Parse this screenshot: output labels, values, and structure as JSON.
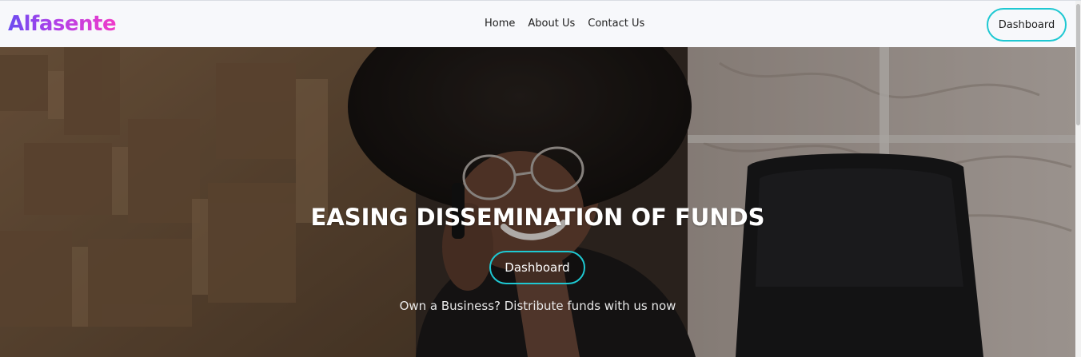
{
  "brand": {
    "name": "Alfasente"
  },
  "nav": {
    "links": [
      "Home",
      "About Us",
      "Contact Us"
    ],
    "dashboard_label": "Dashboard"
  },
  "hero": {
    "title": "EASING DISSEMINATION OF FUNDS",
    "button_label": "Dashboard",
    "subtitle": "Own a Business? Distribute funds with us now"
  },
  "colors": {
    "accent": "#1ec8d2",
    "logo_gradient_start": "#6b4cf0",
    "logo_gradient_end": "#f03cc8",
    "hero_text": "#ffffff"
  },
  "icons": [
    "hero-photo-image"
  ]
}
